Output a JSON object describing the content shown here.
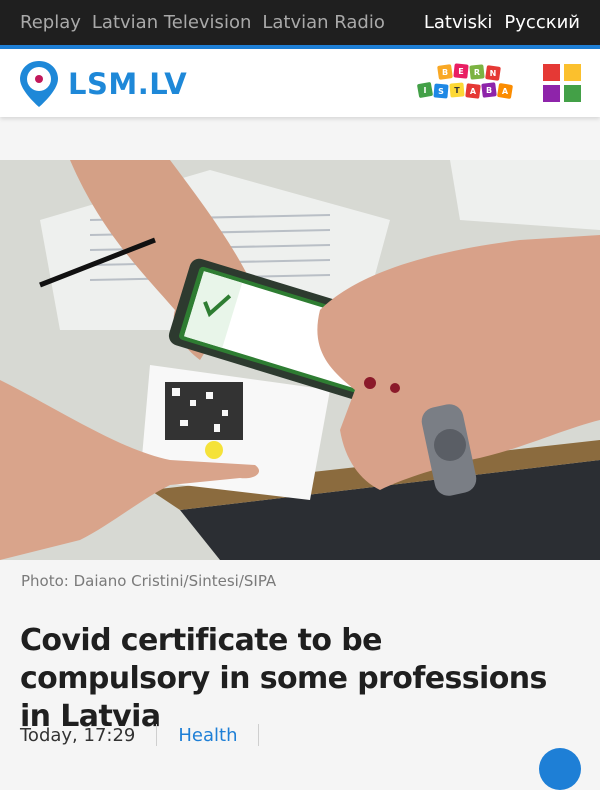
{
  "topbar": {
    "links": [
      "Replay",
      "Latvian Television",
      "Latvian Radio"
    ],
    "languages": [
      "Latviski",
      "Русский"
    ]
  },
  "header": {
    "logo_text": "LSM.LV",
    "kids_logo_letters": [
      "B",
      "E",
      "R",
      "N",
      "I",
      "S",
      "T",
      "A",
      "B",
      "A"
    ],
    "colors": {
      "brand": "#1e88d8",
      "accent": "#1e7fd6"
    },
    "grid_colors": [
      "#e53935",
      "#fbc02d",
      "#8e24aa",
      "#43a047"
    ]
  },
  "article": {
    "photo_alt_icon": "photo-covid-certificate-scan",
    "caption": "Photo: Daiano Cristini/Sintesi/SIPA",
    "title": "Covid certificate to be compulsory in some professions in Latvia",
    "date": "Today, 17:29",
    "category": "Health"
  }
}
